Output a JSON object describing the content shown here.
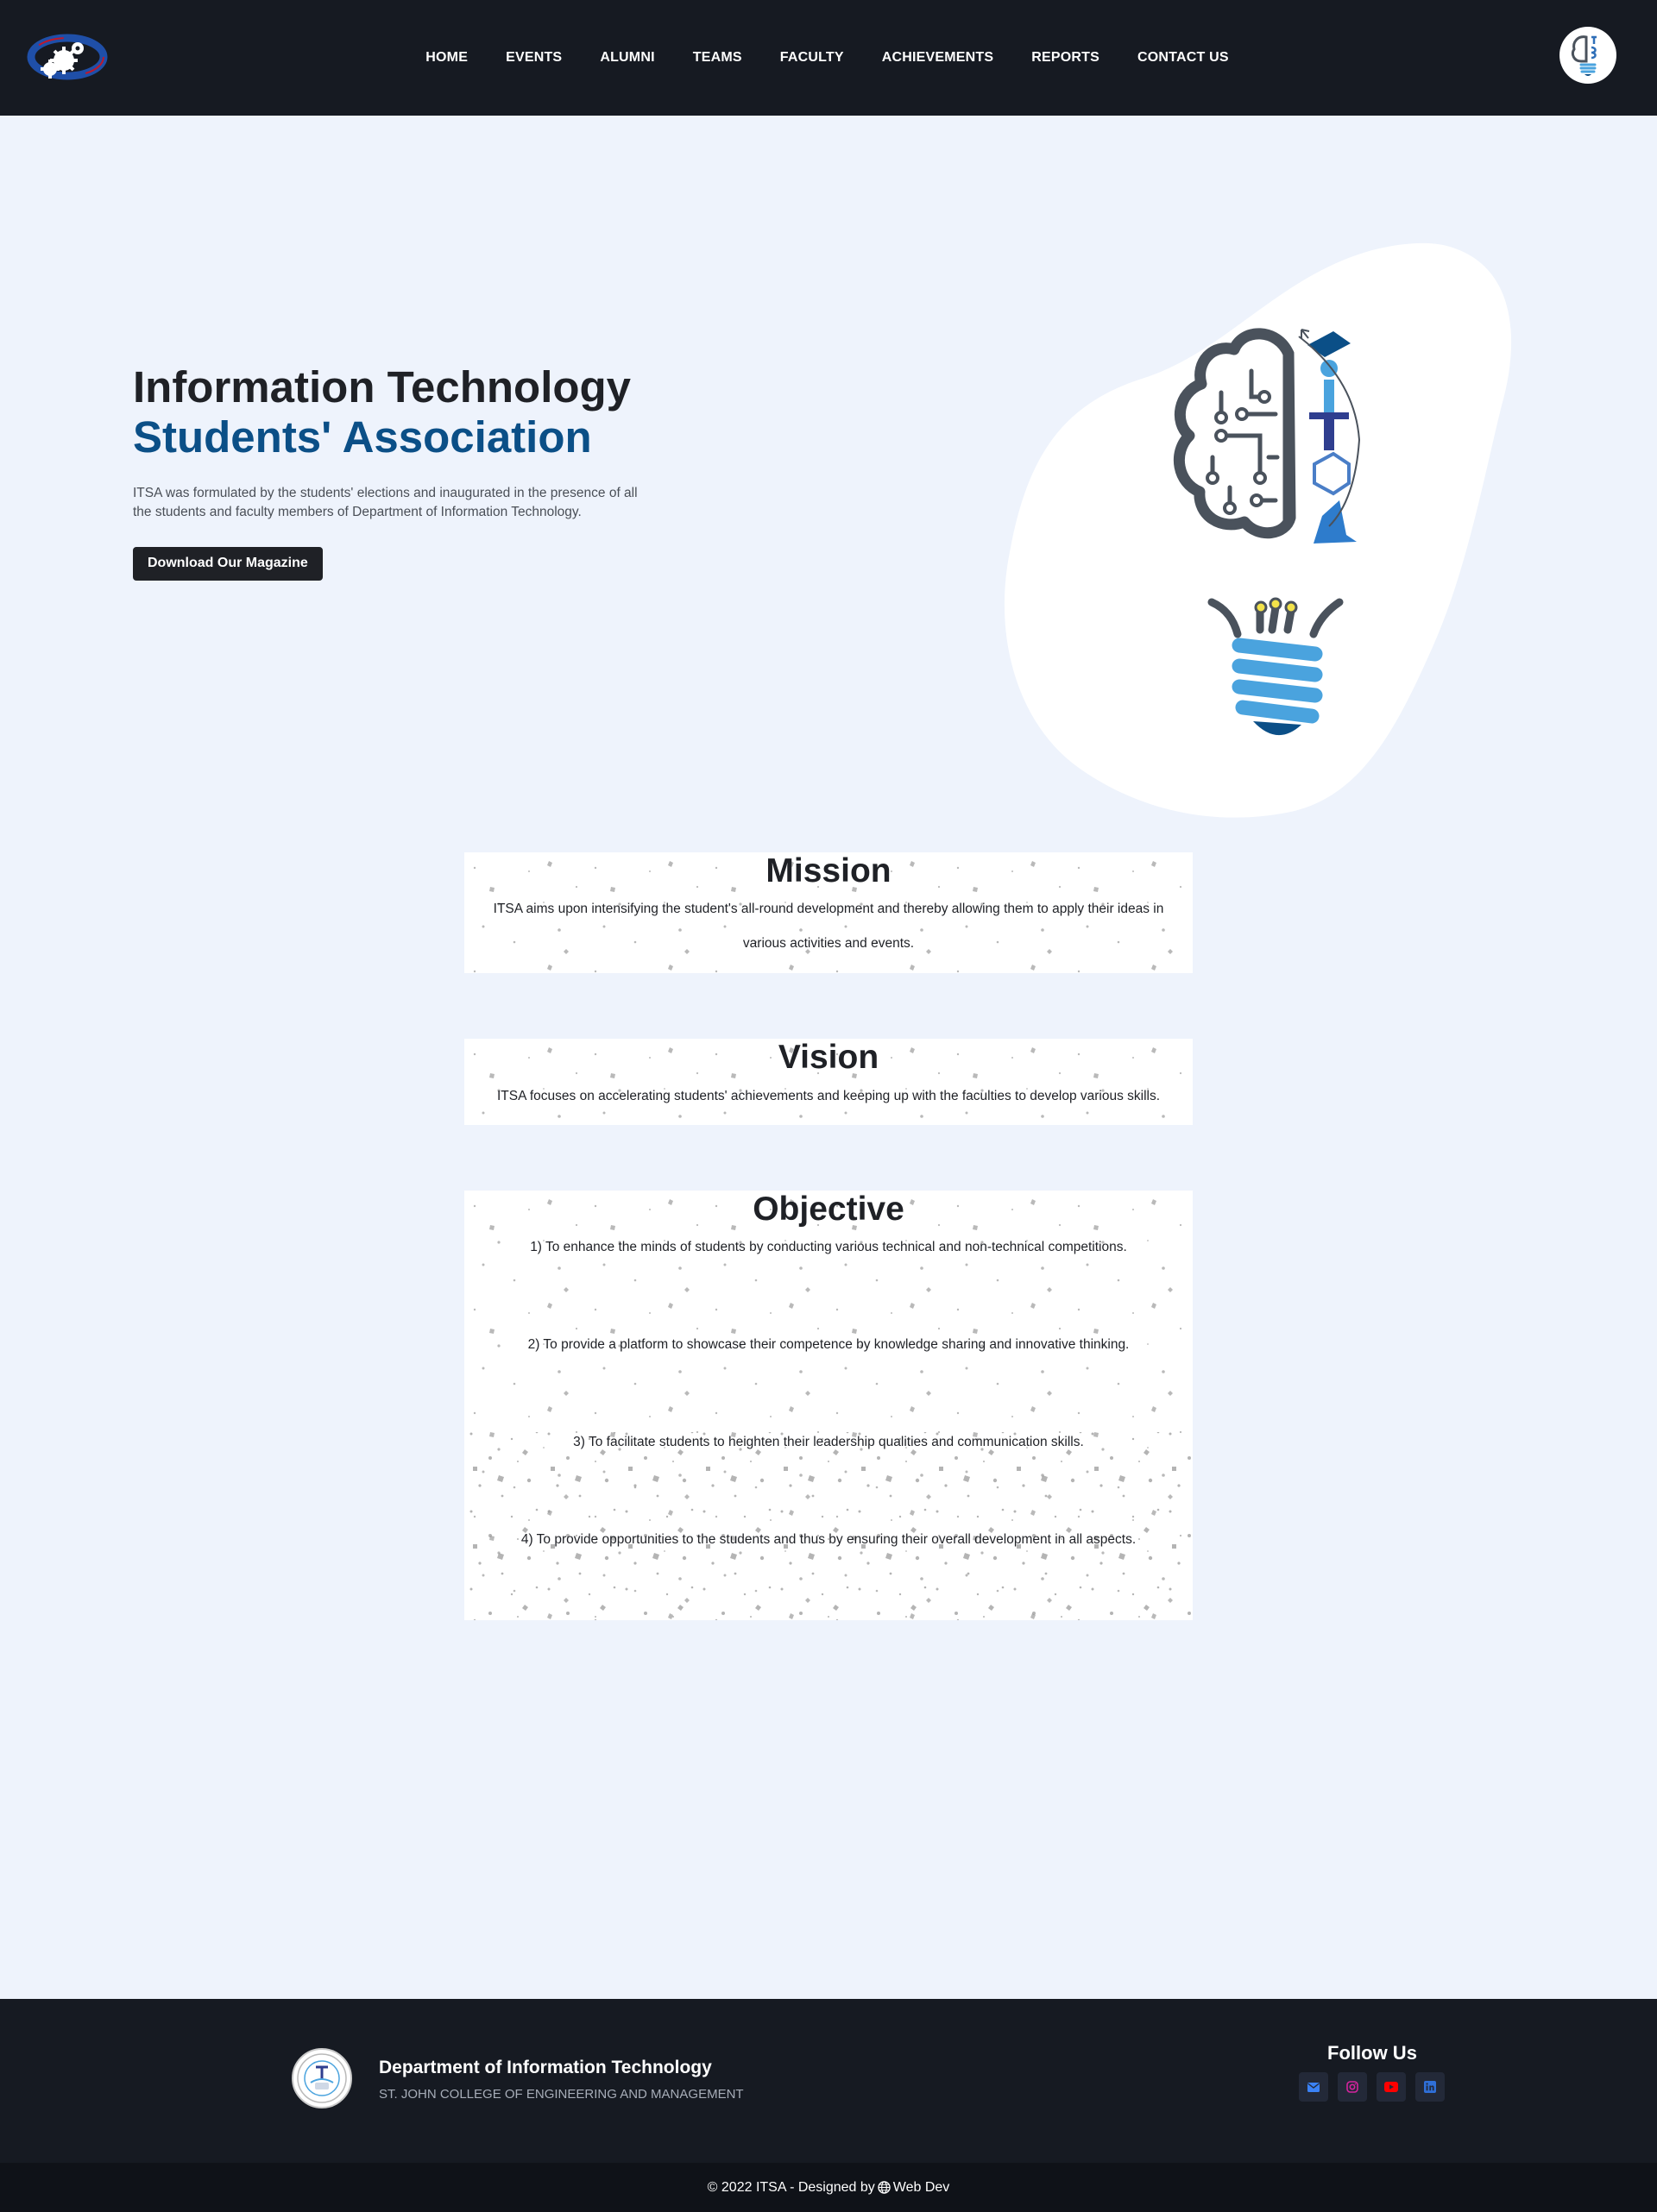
{
  "nav": {
    "logo_alt": "ITSA department logo",
    "items": [
      {
        "label": "HOME"
      },
      {
        "label": "EVENTS"
      },
      {
        "label": "ALUMNI"
      },
      {
        "label": "TEAMS"
      },
      {
        "label": "FACULTY"
      },
      {
        "label": "ACHIEVEMENTS"
      },
      {
        "label": "REPORTS"
      },
      {
        "label": "CONTACT US"
      }
    ]
  },
  "hero": {
    "title_line1": "Information Technology",
    "title_line2": "Students' Association",
    "description": "ITSA was formulated by the students' elections and inaugurated in the presence of all the students and faculty members of Department of Information Technology.",
    "button_label": "Download Our Magazine"
  },
  "mission": {
    "heading": "Mission",
    "text": "ITSA aims upon intensifying the student's all-round development and thereby allowing them to apply their ideas in various activities and events."
  },
  "vision": {
    "heading": "Vision",
    "text": "ITSA focuses on accelerating students' achievements and keeping up with the faculties to develop various skills."
  },
  "objective": {
    "heading": "Objective",
    "items": [
      "1) To enhance the minds of students by conducting various technical and non-technical competitions.",
      "2) To provide a platform to showcase their competence by knowledge sharing and innovative thinking.",
      "3) To facilitate students to heighten their leadership qualities and communication skills.",
      "4) To provide opportunities to the students and thus by ensuring their overall development in all aspects."
    ]
  },
  "footer": {
    "department": "Department of Information Technology",
    "college": "ST. JOHN COLLEGE OF ENGINEERING AND MANAGEMENT",
    "follow_label": "Follow Us",
    "socials": [
      {
        "icon": "envelope-icon",
        "color": "#3b82f6"
      },
      {
        "icon": "instagram-icon",
        "color": "#d6249f"
      },
      {
        "icon": "youtube-icon",
        "color": "#ff0000"
      },
      {
        "icon": "linkedin-icon",
        "color": "#2f6fd8"
      }
    ],
    "copyright_prefix": "© 2022 ITSA - Designed by",
    "copyright_suffix": "Web Dev"
  },
  "colors": {
    "navbar_bg": "#161a22",
    "page_bg": "#eef3fc",
    "accent_blue": "#0b4f87",
    "bulb_blue": "#4aa3de",
    "brain_gray": "#4a525c"
  }
}
